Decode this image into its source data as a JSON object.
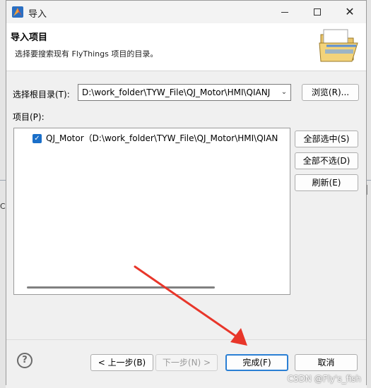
{
  "window": {
    "title": "导入",
    "controls": {
      "minimize": "minimize",
      "maximize": "maximize",
      "close": "✕"
    }
  },
  "header": {
    "title": "导入项目",
    "description": "选择要搜索现有 FlyThings 项目的目录。",
    "icon": "folder-open-icon"
  },
  "root": {
    "label": "选择根目录(T):",
    "value": "D:\\work_folder\\TYW_File\\QJ_Motor\\HMI\\QIANJ",
    "browse_label": "浏览(R)..."
  },
  "projects": {
    "label": "项目(P):",
    "items": [
      {
        "checked": true,
        "text": "QJ_Motor（D:\\work_folder\\TYW_File\\QJ_Motor\\HMI\\QIAN"
      }
    ],
    "select_all_label": "全部选中(S)",
    "deselect_all_label": "全部不选(D)",
    "refresh_label": "刷新(E)"
  },
  "footer": {
    "help_glyph": "?",
    "back_label": "< 上一步(B)",
    "next_label": "下一步(N) >",
    "finish_label": "完成(F)",
    "cancel_label": "取消"
  },
  "background": {
    "left_text": "Co"
  },
  "watermark": "CSDN @Fly's_fish",
  "colors": {
    "accent": "#1a6fc9",
    "arrow": "#e8362a",
    "finish_border": "#2a7fd4"
  }
}
